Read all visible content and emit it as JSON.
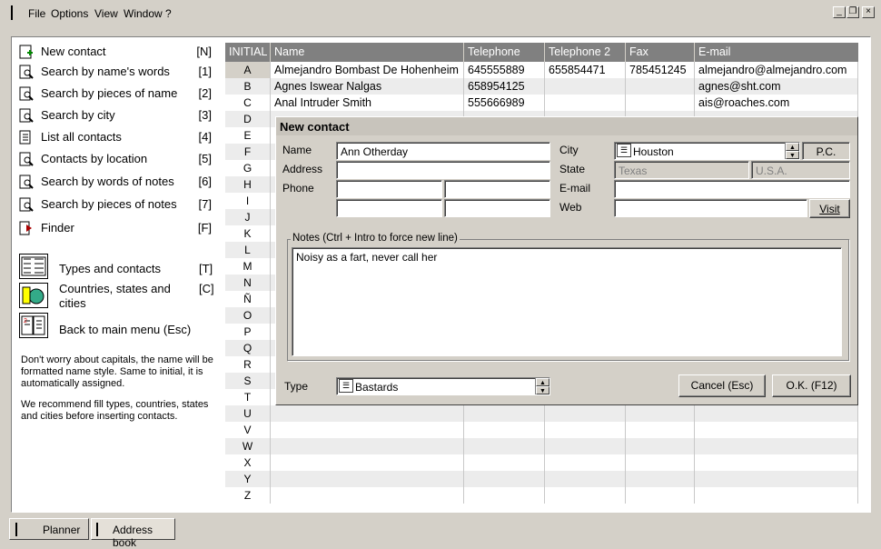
{
  "menu": {
    "file": "File",
    "options": "Options",
    "view": "View",
    "window": "Window",
    "help": "?"
  },
  "sidebar": {
    "items": [
      {
        "label": "New contact",
        "key": "[N]"
      },
      {
        "label": "Search by name's words",
        "key": "[1]"
      },
      {
        "label": "Search by pieces of name",
        "key": "[2]"
      },
      {
        "label": "Search by city",
        "key": "[3]"
      },
      {
        "label": "List all contacts",
        "key": "[4]"
      },
      {
        "label": "Contacts by location",
        "key": "[5]"
      },
      {
        "label": "Search by words of notes",
        "key": "[6]"
      },
      {
        "label": "Search by pieces of notes",
        "key": "[7]"
      },
      {
        "label": "Finder",
        "key": "[F]"
      }
    ],
    "big_items": [
      {
        "label": "Types and contacts",
        "key": "[T]"
      },
      {
        "label": "Countries, states and cities",
        "key": "[C]"
      },
      {
        "label": "Back to main menu (Esc)",
        "key": ""
      }
    ],
    "note1": "Don't worry about capitals, the name will be formatted name style. Same to initial, it is automatically assigned.",
    "note2": "We recommend fill types, countries, states and cities before inserting contacts."
  },
  "grid": {
    "headers": [
      "INITIAL",
      "Name",
      "Telephone",
      "Telephone 2",
      "Fax",
      "E-mail"
    ],
    "initials": [
      "A",
      "B",
      "C",
      "D",
      "E",
      "F",
      "G",
      "H",
      "I",
      "J",
      "K",
      "L",
      "M",
      "N",
      "Ñ",
      "O",
      "P",
      "Q",
      "R",
      "S",
      "T",
      "U",
      "V",
      "W",
      "X",
      "Y",
      "Z"
    ],
    "rows": [
      {
        "name": "Almejandro Bombast De Hohenheim",
        "tel": "645555889",
        "tel2": "655854471",
        "fax": "785451245",
        "email": "almejandro@almejandro.com"
      },
      {
        "name": "Agnes Iswear Nalgas",
        "tel": "658954125",
        "tel2": "",
        "fax": "",
        "email": "agnes@sht.com"
      },
      {
        "name": "Anal Intruder Smith",
        "tel": "555666989",
        "tel2": "",
        "fax": "",
        "email": "ais@roaches.com"
      }
    ]
  },
  "dialog": {
    "title": "New contact",
    "name_label": "Name",
    "name_value": "Ann Otherday",
    "address_label": "Address",
    "address_value": "",
    "phone_label": "Phone",
    "city_label": "City",
    "city_value": "Houston",
    "pc_label": "P.C.",
    "state_label": "State",
    "state_value": "Texas",
    "country_value": "U.S.A.",
    "email_label": "E-mail",
    "web_label": "Web",
    "visit_label": "Visit",
    "notes_legend": "Notes (Ctrl + Intro to force new line)",
    "notes_value": "Noisy as a fart, never call her",
    "type_label": "Type",
    "type_value": "Bastards",
    "cancel_label": "Cancel (Esc)",
    "ok_label": "O.K. (F12)"
  },
  "tabs": [
    {
      "label": "Planner"
    },
    {
      "label": "Address book"
    }
  ],
  "colors": {
    "header_bg": "#808080",
    "selected_initial": "#d4d0c8",
    "row_alt": "#ececec"
  }
}
